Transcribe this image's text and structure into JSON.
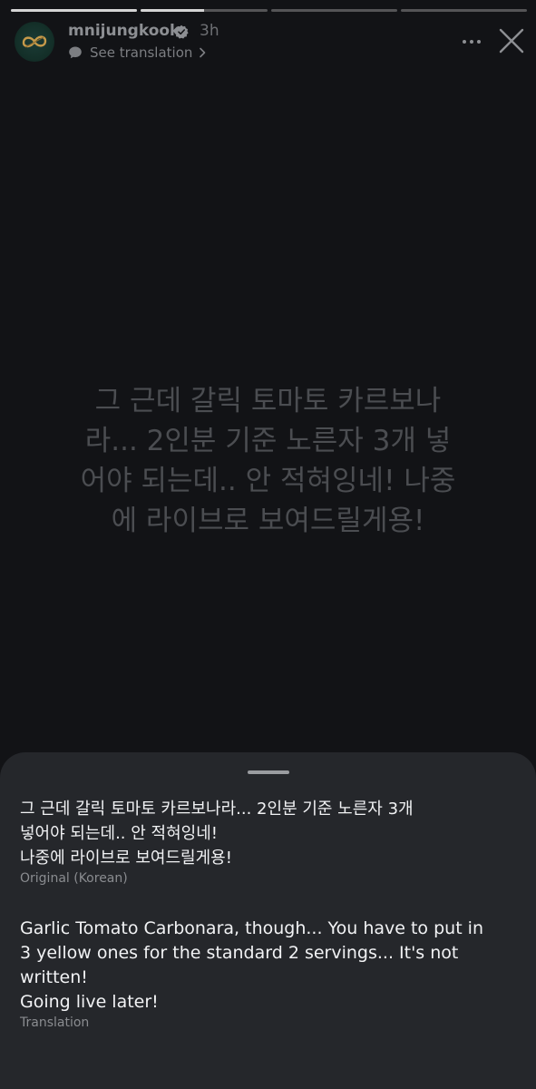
{
  "story": {
    "progress": [
      1.0,
      0.5,
      0.0,
      0.0
    ],
    "text": "그 근데 갈릭 토마토 카르보나라... 2인분 기준 노른자 3개 넣어야 되는데.. 안 적혀잉네! 나중에 라이브로 보여드릴게용!"
  },
  "header": {
    "username": "mnijungkook",
    "time": "3h",
    "see_translation": "See translation",
    "avatar_icon": "infinity-logo-icon",
    "verified_icon": "verified-badge-icon",
    "more_icon": "more-dots-icon",
    "close_icon": "close-icon"
  },
  "translation_sheet": {
    "original_text": "그 근데 갈릭 토마토 카르보나라... 2인분 기준 노른자 3개\n넣어야 되는데.. 안 적혀잉네!\n나중에 라이브로 보여드릴게용!",
    "original_label": "Original (Korean)",
    "translation_text": "Garlic Tomato Carbonara, though... You have to put in\n3 yellow ones for the standard 2 servings... It's not\nwritten!\nGoing live later!",
    "translation_label": "Translation"
  },
  "colors": {
    "background": "#121316",
    "sheet": "#25272b",
    "story_text": "#4b4d51"
  }
}
